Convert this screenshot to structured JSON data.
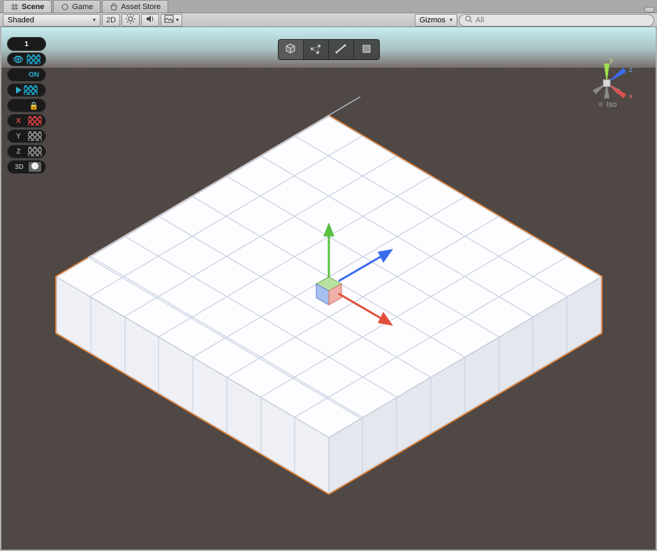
{
  "tabs": {
    "scene": "Scene",
    "game": "Game",
    "asset_store": "Asset Store"
  },
  "toolbar": {
    "shading_mode": "Shaded",
    "btn_2d": "2D",
    "gizmos_label": "Gizmos",
    "search_placeholder": "All"
  },
  "badges": {
    "one": "1",
    "on": "ON",
    "x": "X",
    "y": "Y",
    "z": "Z",
    "d3": "3D"
  },
  "orientation": {
    "x": "x",
    "y": "y",
    "z": "z",
    "projection": "Iso"
  }
}
